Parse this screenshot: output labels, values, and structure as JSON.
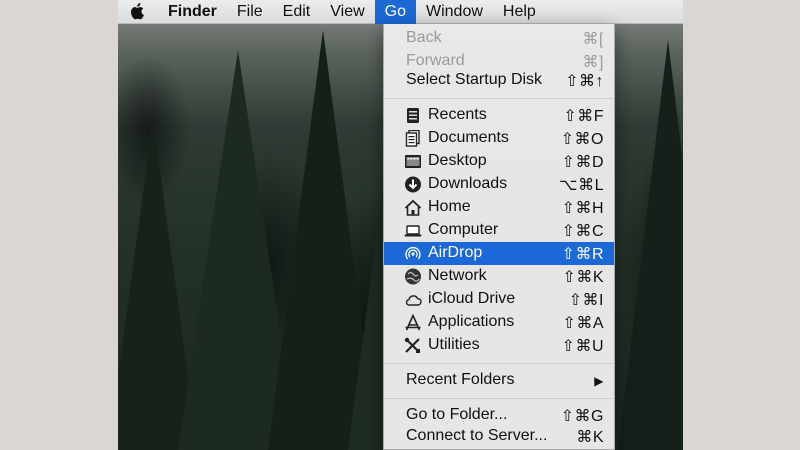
{
  "menubar": {
    "app": "Finder",
    "items": [
      "File",
      "Edit",
      "View",
      "Go",
      "Window",
      "Help"
    ],
    "active": "Go"
  },
  "go_menu": {
    "group1": [
      {
        "label": "Back",
        "shortcut": "⌘[",
        "disabled": true
      },
      {
        "label": "Forward",
        "shortcut": "⌘]",
        "disabled": true
      },
      {
        "label": "Select Startup Disk",
        "shortcut": "⇧⌘↑",
        "disabled": false
      }
    ],
    "group2": [
      {
        "label": "Recents",
        "shortcut": "⇧⌘F",
        "icon": "recents-icon"
      },
      {
        "label": "Documents",
        "shortcut": "⇧⌘O",
        "icon": "documents-icon"
      },
      {
        "label": "Desktop",
        "shortcut": "⇧⌘D",
        "icon": "desktop-icon"
      },
      {
        "label": "Downloads",
        "shortcut": "⌥⌘L",
        "icon": "downloads-icon"
      },
      {
        "label": "Home",
        "shortcut": "⇧⌘H",
        "icon": "home-icon"
      },
      {
        "label": "Computer",
        "shortcut": "⇧⌘C",
        "icon": "computer-icon"
      },
      {
        "label": "AirDrop",
        "shortcut": "⇧⌘R",
        "icon": "airdrop-icon",
        "highlighted": true
      },
      {
        "label": "Network",
        "shortcut": "⇧⌘K",
        "icon": "network-icon"
      },
      {
        "label": "iCloud Drive",
        "shortcut": "⇧⌘I",
        "icon": "icloud-icon"
      },
      {
        "label": "Applications",
        "shortcut": "⇧⌘A",
        "icon": "applications-icon"
      },
      {
        "label": "Utilities",
        "shortcut": "⇧⌘U",
        "icon": "utilities-icon"
      }
    ],
    "recent_folders": {
      "label": "Recent Folders",
      "submenu_glyph": "▶"
    },
    "group4": [
      {
        "label": "Go to Folder...",
        "shortcut": "⇧⌘G"
      },
      {
        "label": "Connect to Server...",
        "shortcut": "⌘K"
      }
    ]
  },
  "colors": {
    "highlight": "#1b68d6",
    "disabled_text": "#9a9a9a"
  }
}
